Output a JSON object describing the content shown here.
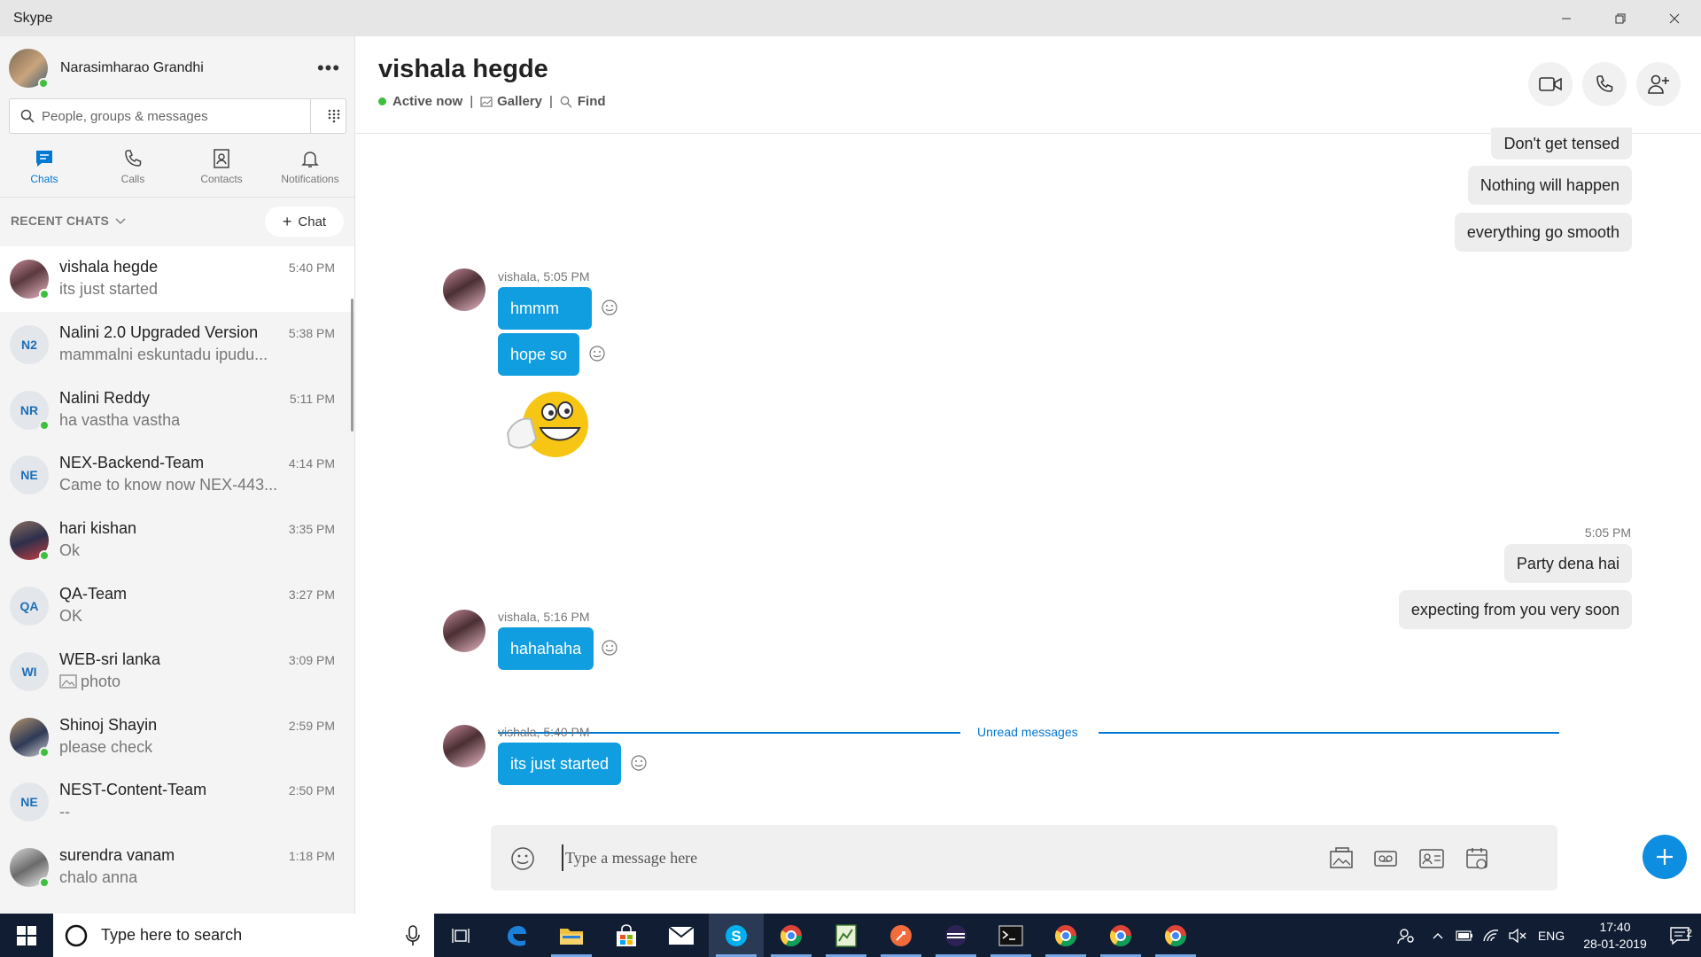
{
  "window": {
    "title": "Skype"
  },
  "profile": {
    "name": "Narasimharao Grandhi",
    "more_label": "•••"
  },
  "search": {
    "placeholder": "People, groups & messages"
  },
  "tabs": [
    {
      "label": "Chats",
      "icon": "chat-icon"
    },
    {
      "label": "Calls",
      "icon": "phone-icon"
    },
    {
      "label": "Contacts",
      "icon": "contacts-icon"
    },
    {
      "label": "Notifications",
      "icon": "bell-icon"
    }
  ],
  "recent": {
    "header": "RECENT CHATS",
    "new_chat_label": "Chat"
  },
  "chats": [
    {
      "name": "vishala hegde",
      "time": "5:40 PM",
      "preview": "its just started",
      "initials": "",
      "online": true
    },
    {
      "name": "Nalini 2.0 Upgraded Version",
      "time": "5:38 PM",
      "preview": "mammalni eskuntadu ipudu...",
      "initials": "N2",
      "online": false
    },
    {
      "name": "Nalini Reddy",
      "time": "5:11 PM",
      "preview": "ha vastha vastha",
      "initials": "NR",
      "online": true
    },
    {
      "name": "NEX-Backend-Team",
      "time": "4:14 PM",
      "preview": "Came to know now NEX-443...",
      "initials": "NE",
      "online": false
    },
    {
      "name": "hari kishan",
      "time": "3:35 PM",
      "preview": "Ok",
      "initials": "",
      "online": true
    },
    {
      "name": "QA-Team",
      "time": "3:27 PM",
      "preview": "OK",
      "initials": "QA",
      "online": false
    },
    {
      "name": "WEB-sri lanka",
      "time": "3:09 PM",
      "preview": "photo",
      "initials": "WI",
      "online": false
    },
    {
      "name": "Shinoj Shayin",
      "time": "2:59 PM",
      "preview": "please check",
      "initials": "",
      "online": true
    },
    {
      "name": "NEST-Content-Team",
      "time": "2:50 PM",
      "preview": "--",
      "initials": "NE",
      "online": false
    },
    {
      "name": "surendra vanam",
      "time": "1:18 PM",
      "preview": "chalo anna",
      "initials": "",
      "online": true
    }
  ],
  "conversation": {
    "title": "vishala hegde",
    "status": "Active now",
    "gallery": "Gallery",
    "find": "Find"
  },
  "messages": {
    "out_1": [
      "Don't get tensed",
      "Nothing will happen",
      "everything go smooth"
    ],
    "in_1_meta": "vishala, 5:05 PM",
    "in_1": [
      "hmmm",
      "hope so"
    ],
    "out_2_meta": "5:05 PM",
    "out_2": [
      "Party dena hai",
      "expecting from you very soon"
    ],
    "in_2_meta": "vishala, 5:16 PM",
    "in_2": [
      "hahahaha"
    ],
    "unread_label": "Unread messages",
    "in_3_meta": "vishala, 5:40 PM",
    "in_3": [
      "its just started"
    ]
  },
  "composer": {
    "placeholder": "Type a message here"
  },
  "taskbar": {
    "search_placeholder": "Type here to search",
    "language": "ENG",
    "time": "17:40",
    "date": "28-01-2019",
    "notification_count": "2"
  },
  "colors": {
    "accent": "#0078d4",
    "bubble_in": "#119ee0",
    "bubble_out": "#ededed",
    "online": "#3fbf3f",
    "taskbar": "#101d33"
  }
}
